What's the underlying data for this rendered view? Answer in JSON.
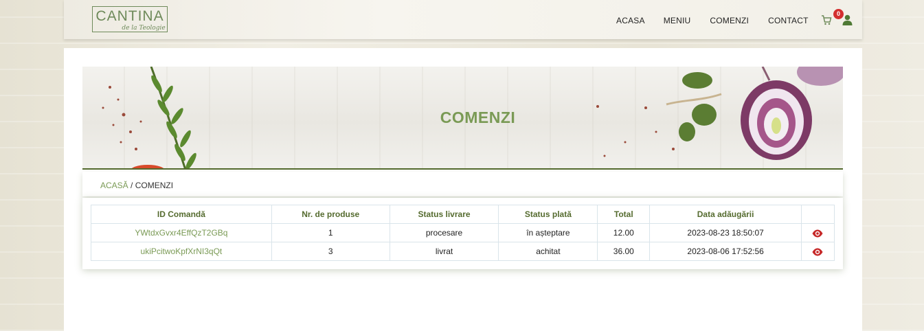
{
  "header": {
    "logo_main": "CANTINA",
    "logo_sub": "de la Teologie",
    "nav": [
      "ACASA",
      "MENIU",
      "COMENZI",
      "CONTACT"
    ],
    "cart_count": "0"
  },
  "hero": {
    "title": "COMENZI"
  },
  "breadcrumb": {
    "home": "ACASĂ",
    "separator": " / ",
    "current": "COMENZI"
  },
  "orders": {
    "columns": [
      "ID Comandă",
      "Nr. de produse",
      "Status livrare",
      "Status plată",
      "Total",
      "Data adăugării",
      ""
    ],
    "rows": [
      {
        "id": "YWtdxGvxr4EffQzT2GBq",
        "count": "1",
        "delivery": "procesare",
        "payment": "în așteptare",
        "total": "12.00",
        "date": "2023-08-23 18:50:07"
      },
      {
        "id": "ukiPcitwoKpfXrNI3qQt",
        "count": "3",
        "delivery": "livrat",
        "payment": "achitat",
        "total": "36.00",
        "date": "2023-08-06 17:52:56"
      }
    ]
  },
  "colors": {
    "accent": "#7a9a55",
    "heading": "#556b2f",
    "badge": "#d32f2f",
    "eye": "#c62828"
  }
}
